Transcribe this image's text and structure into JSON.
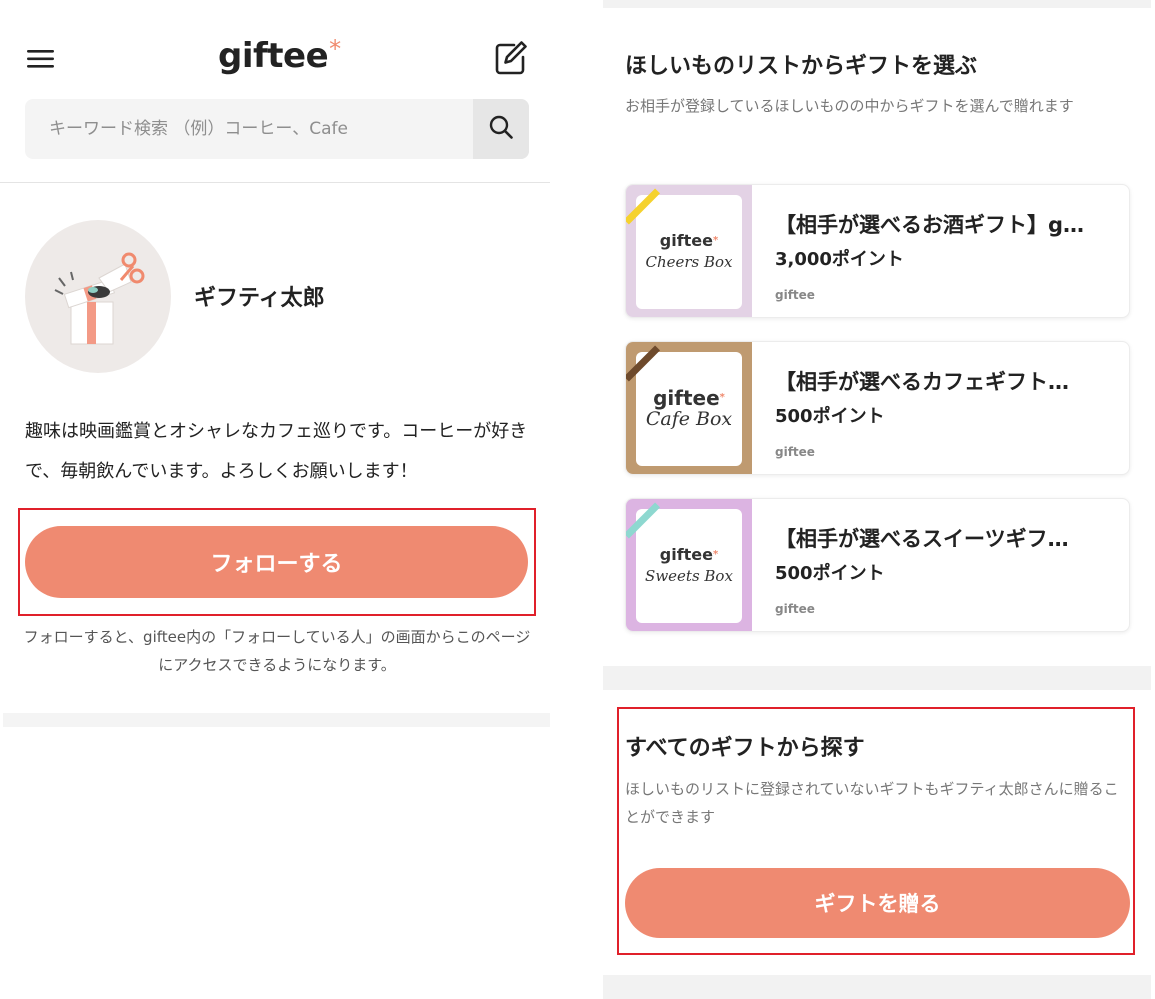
{
  "header": {
    "logo_text": "giftee",
    "logo_mark": "*",
    "menu_icon": "hamburger-menu-icon",
    "edit_icon": "edit-icon"
  },
  "search": {
    "placeholder": "キーワード検索 （例）コーヒー、Cafe",
    "button_icon": "search-icon"
  },
  "profile": {
    "name": "ギフティ太郎",
    "bio": "趣味は映画鑑賞とオシャレなカフェ巡りです。コーヒーが好きで、毎朝飲んでいます。よろしくお願いします！",
    "follow_label": "フォローする",
    "follow_note": "フォローすると、giftee内の「フォローしている人」の画面からこのページにアクセスできるようになります。"
  },
  "wishlist": {
    "title": "ほしいものリストからギフトを選ぶ",
    "description": "お相手が登録しているほしいものの中からギフトを選んで贈れます",
    "items": [
      {
        "title": "【相手が選べるお酒ギフト】g…",
        "price": "3,000ポイント",
        "brand": "giftee",
        "thumb_brand": "giftee",
        "thumb_box": "Cheers Box",
        "bg_color": "#e3d2e5",
        "ribbon_color": "#f5d22e"
      },
      {
        "title": "【相手が選べるカフェギフト…",
        "price": "500ポイント",
        "brand": "giftee",
        "thumb_brand": "giftee",
        "thumb_box": "Cafe Box",
        "bg_color": "#bf9a70",
        "ribbon_color": "#6e4a2c"
      },
      {
        "title": "【相手が選べるスイーツギフ…",
        "price": "500ポイント",
        "brand": "giftee",
        "thumb_brand": "giftee",
        "thumb_box": "Sweets Box",
        "bg_color": "#dcb4e2",
        "ribbon_color": "#8ed8d0"
      }
    ]
  },
  "all_gifts": {
    "title": "すべてのギフトから探す",
    "description": "ほしいものリストに登録されていないギフトもギフティ太郎さんに贈ることができます",
    "button_label": "ギフトを贈る"
  },
  "colors": {
    "accent": "#ef8a71",
    "highlight_frame": "#e0202a"
  }
}
